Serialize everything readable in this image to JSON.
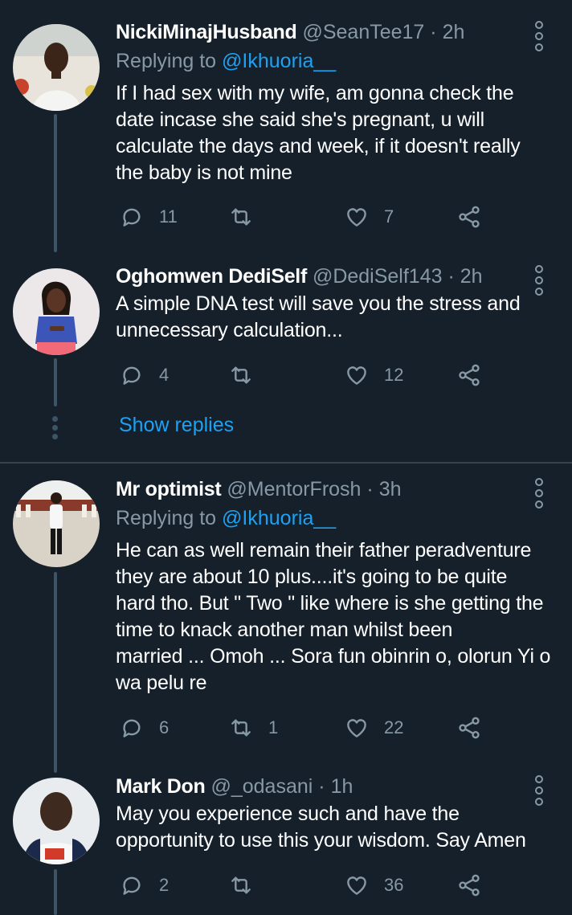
{
  "tweets": [
    {
      "name": "NickiMinajHusband",
      "handle": "@SeanTee17",
      "dot": "·",
      "time": "2h",
      "replying_label": "Replying to",
      "replying_to": "@Ikhuoria__",
      "lines": [
        "If I had sex with my wife, am gonna check the",
        "date incase she said she's pregnant, u will",
        "calculate the days and week, if it doesn't really",
        "the baby is not mine"
      ],
      "replies": "11",
      "retweets": "",
      "likes": "7"
    },
    {
      "name": "Oghomwen DediSelf",
      "handle": "@DediSelf143",
      "dot": "·",
      "time": "2h",
      "lines": [
        "A simple DNA test will save you the stress and",
        "unnecessary calculation..."
      ],
      "replies": "4",
      "retweets": "",
      "likes": "12"
    },
    {
      "name": "Mr optimist",
      "handle": "@MentorFrosh",
      "dot": "·",
      "time": "3h",
      "replying_label": "Replying to",
      "replying_to": "@Ikhuoria__",
      "lines": [
        "He can as well remain their father peradventure",
        "they are about 10 plus....it's going to be quite",
        "hard tho. But \" Two \" like where is she getting the",
        "time to knack another man whilst been",
        "married ... Omoh ... Sora fun obinrin o, olorun Yi o",
        "wa pelu re"
      ],
      "replies": "6",
      "retweets": "1",
      "likes": "22"
    },
    {
      "name": "Mark Don",
      "handle": "@_odasani",
      "dot": "·",
      "time": "1h",
      "lines": [
        "May you experience such and have the",
        "opportunity to use this your wisdom. Say Amen"
      ],
      "replies": "2",
      "retweets": "",
      "likes": "36"
    }
  ],
  "show_replies": "Show replies",
  "colors": {
    "background": "#15202b",
    "secondary_text": "#8899a6",
    "accent": "#1da1f2",
    "thread_line": "#3d5466"
  },
  "icons": [
    "reply-icon",
    "retweet-icon",
    "like-icon",
    "share-icon",
    "more-options-icon"
  ]
}
